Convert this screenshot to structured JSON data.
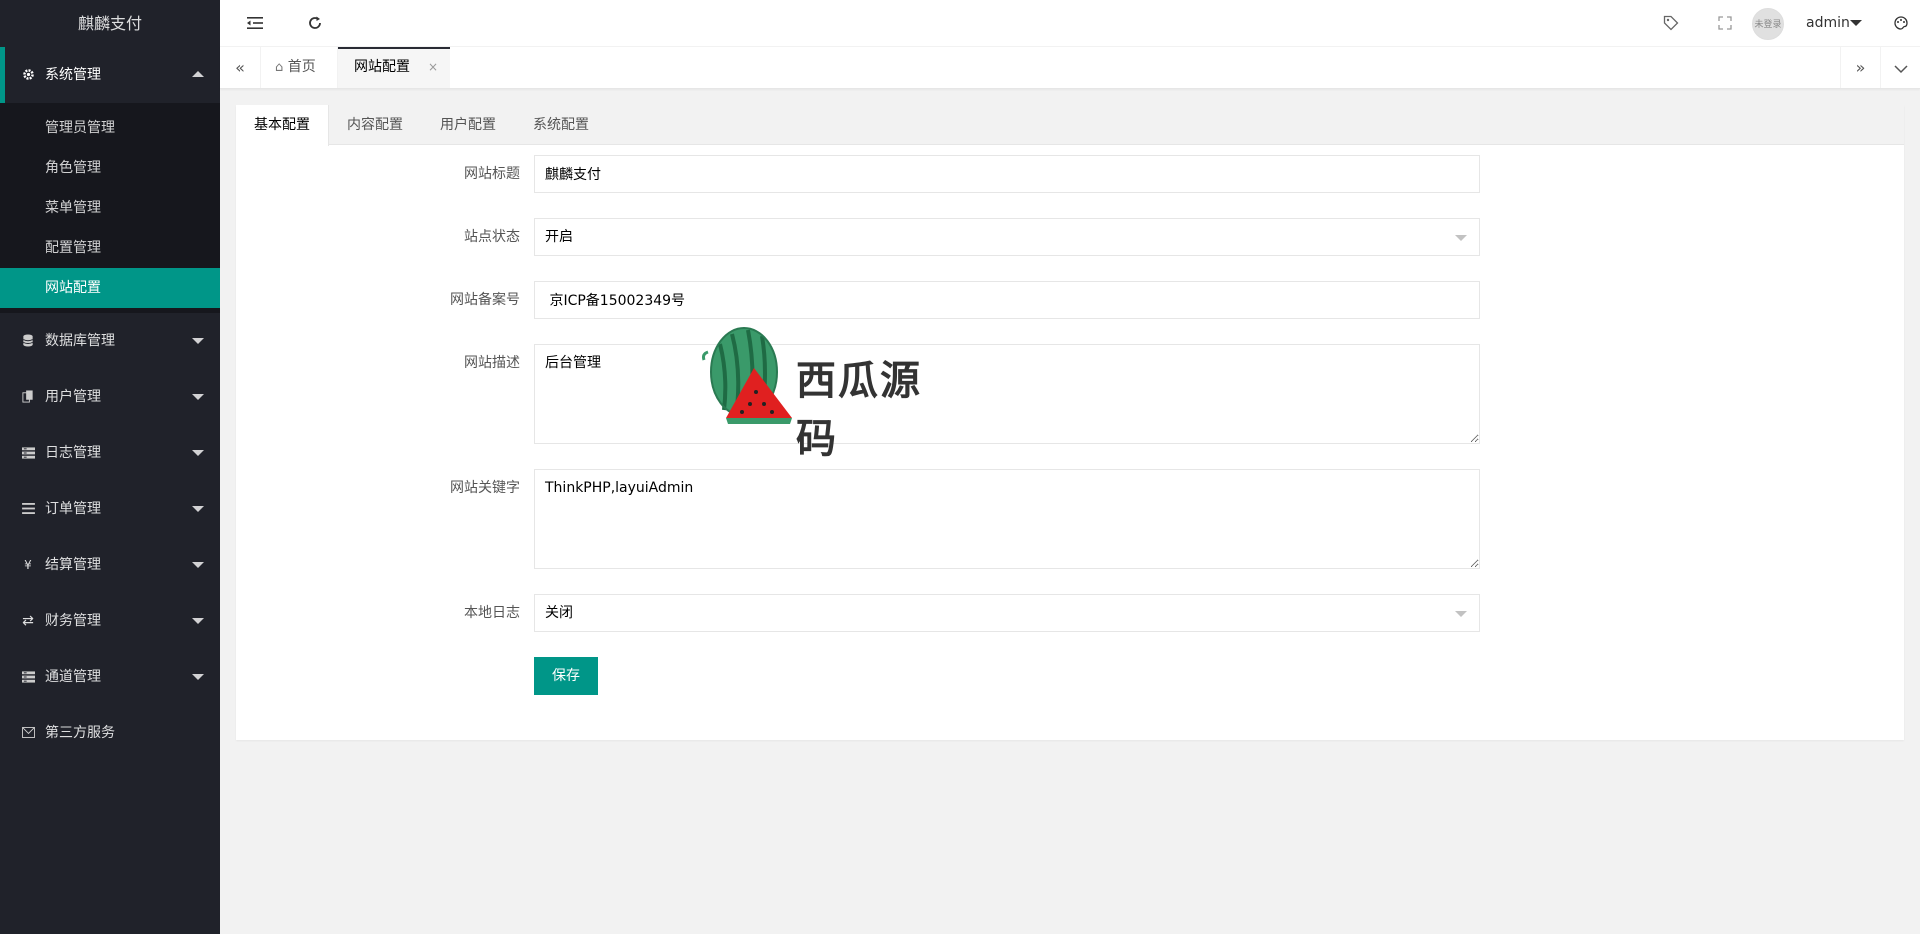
{
  "app": {
    "title": "麒麟支付"
  },
  "sidebar": {
    "groups": [
      {
        "label": "系统管理",
        "icon": "gear-icon",
        "expanded": true,
        "items": [
          "管理员管理",
          "角色管理",
          "菜单管理",
          "配置管理",
          "网站配置"
        ]
      },
      {
        "label": "数据库管理",
        "icon": "database-icon"
      },
      {
        "label": "用户管理",
        "icon": "users-icon"
      },
      {
        "label": "日志管理",
        "icon": "log-icon"
      },
      {
        "label": "订单管理",
        "icon": "list-icon"
      },
      {
        "label": "结算管理",
        "icon": "yen-icon"
      },
      {
        "label": "财务管理",
        "icon": "transfer-icon"
      },
      {
        "label": "通道管理",
        "icon": "channel-icon"
      },
      {
        "label": "第三方服务",
        "icon": "mail-icon"
      }
    ],
    "current_item": "网站配置"
  },
  "header": {
    "user": "admin",
    "avatar_text": "未登录"
  },
  "tabbar": {
    "home": "首页",
    "active": "网站配置",
    "close": "×"
  },
  "config_tabs": [
    "基本配置",
    "内容配置",
    "用户配置",
    "系统配置"
  ],
  "form": {
    "site_title_label": "网站标题",
    "site_title_value": "麒麟支付",
    "site_status_label": "站点状态",
    "site_status_value": "开启",
    "icp_label": "网站备案号",
    "icp_value": " 京ICP备15002349号",
    "desc_label": "网站描述",
    "desc_value": "后台管理",
    "keywords_label": "网站关键字",
    "keywords_value": "ThinkPHP,layuiAdmin",
    "local_log_label": "本地日志",
    "local_log_value": "关闭",
    "save_label": "保存"
  },
  "watermark": {
    "text": "西瓜源码"
  },
  "colors": {
    "accent": "#009688",
    "sidebar_bg": "#20222a"
  }
}
